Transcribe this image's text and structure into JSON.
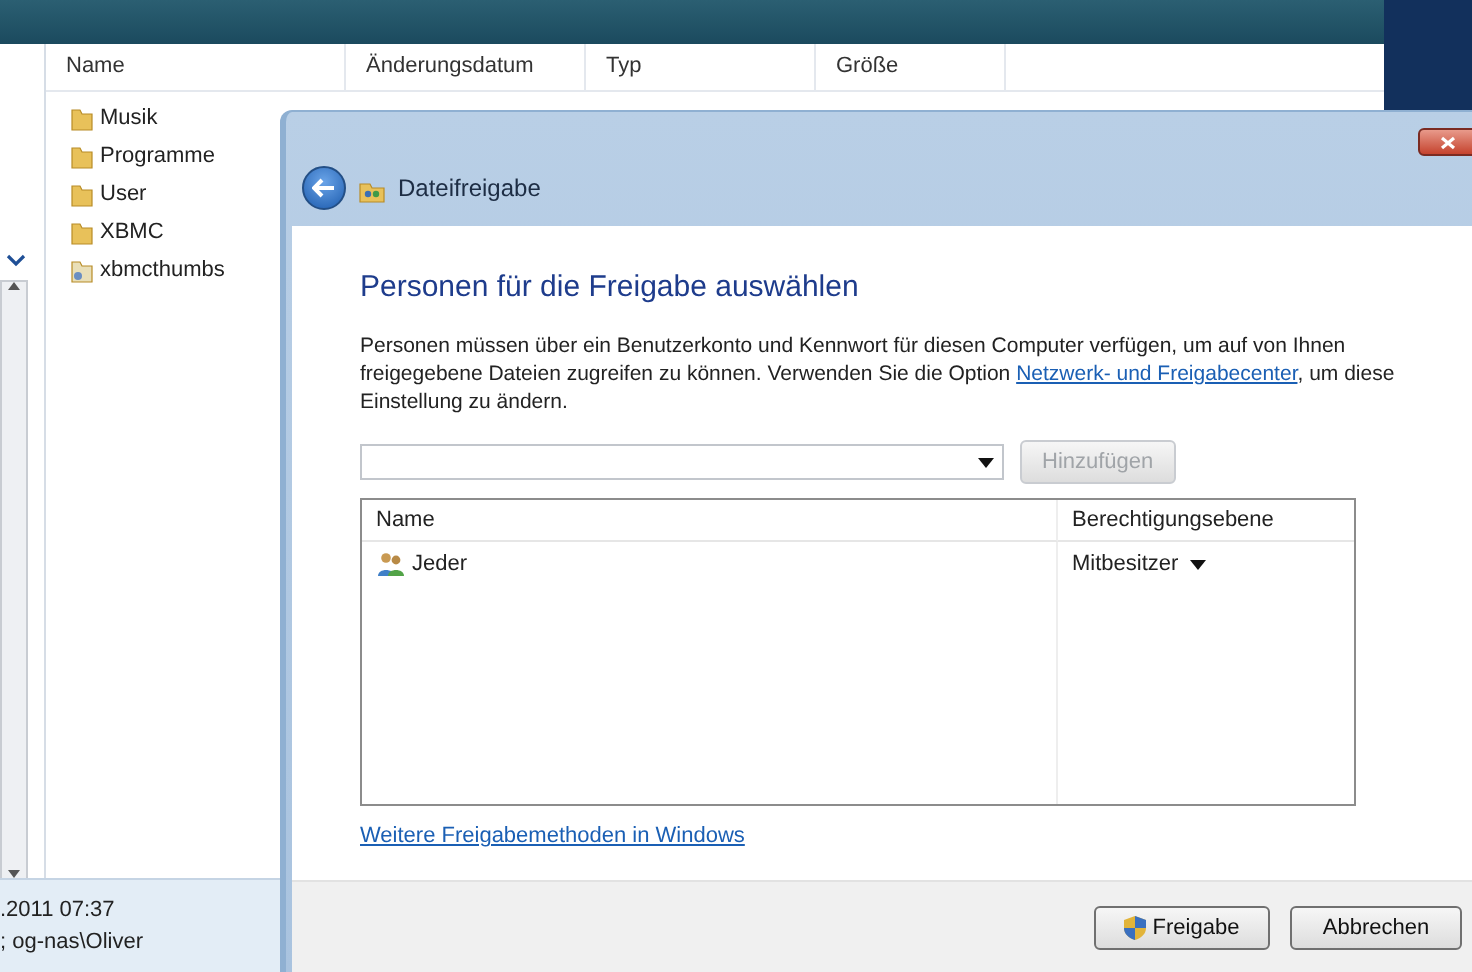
{
  "explorer": {
    "columns": [
      "Name",
      "Änderungsdatum",
      "Typ",
      "Größe"
    ],
    "files": [
      {
        "name": "Musik",
        "kind": "folder"
      },
      {
        "name": "Programme",
        "kind": "folder"
      },
      {
        "name": "User",
        "kind": "folder"
      },
      {
        "name": "XBMC",
        "kind": "folder"
      },
      {
        "name": "xbmcthumbs",
        "kind": "shared"
      }
    ],
    "details": [
      ".2011 07:37",
      "; og-nas\\Oliver"
    ]
  },
  "dialog": {
    "title": "Dateifreigabe",
    "heading": "Personen für die Freigabe auswählen",
    "text_before": "Personen müssen über ein Benutzerkonto und Kennwort für diesen Computer verfügen, um auf von Ihnen freigegebene Dateien zugreifen zu können. Verwenden Sie die Option ",
    "link": "Netzwerk- und Freigabecenter",
    "text_after": ", um diese Einstellung zu ändern.",
    "add_button": {
      "label": "Hinzufügen",
      "disabled": true
    },
    "table": {
      "columns": [
        "Name",
        "Berechtigungsebene"
      ],
      "rows": [
        {
          "name": "Jeder",
          "permission": "Mitbesitzer"
        }
      ]
    },
    "more_link": "Weitere Freigabemethoden in Windows",
    "buttons": [
      {
        "label": "Freigabe",
        "kind": "shield"
      },
      {
        "label": "Abbrechen",
        "kind": "plain"
      }
    ]
  }
}
